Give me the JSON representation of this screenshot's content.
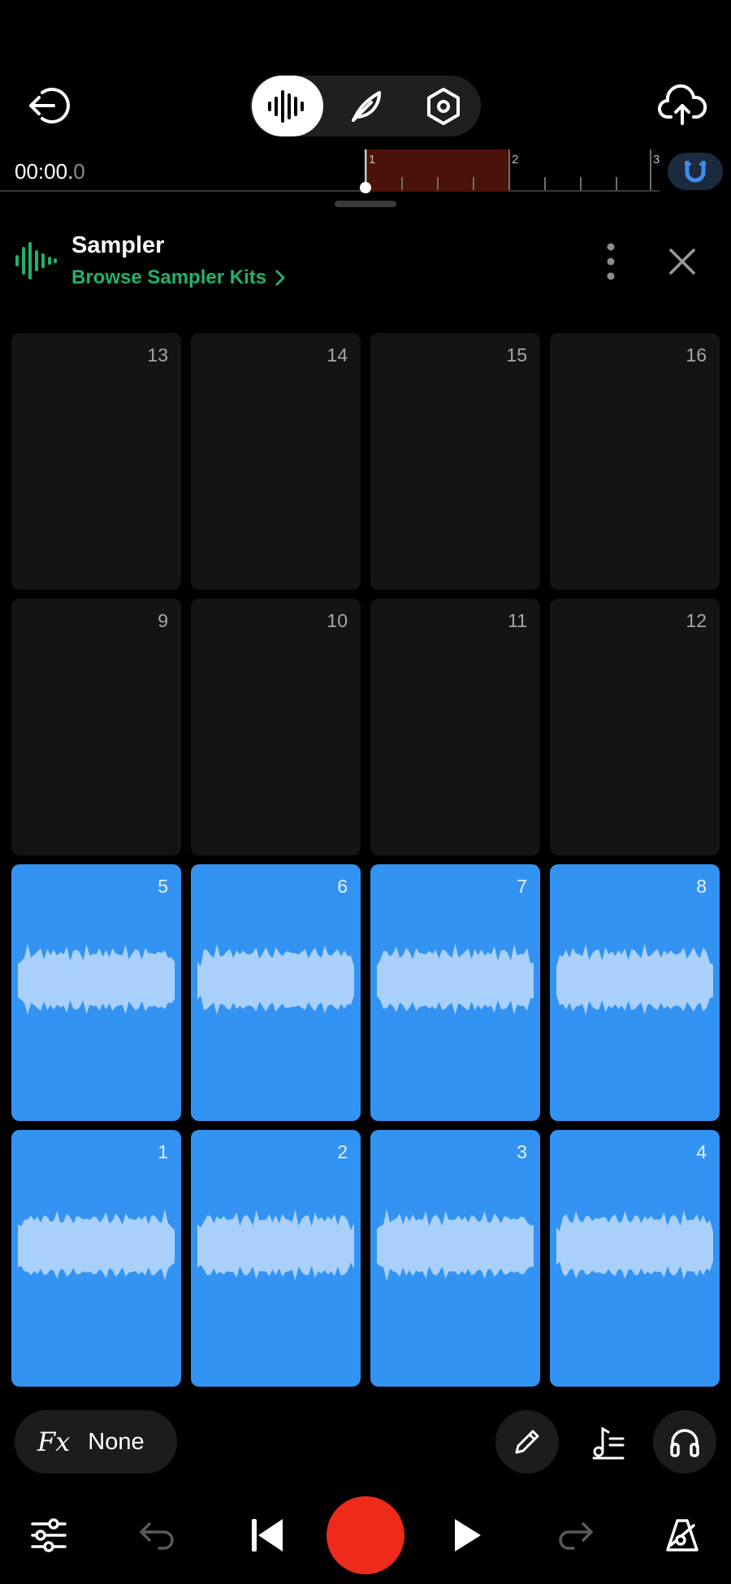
{
  "header": {
    "modes": [
      {
        "name": "instrument-mode",
        "active": true
      },
      {
        "name": "compose-mode",
        "active": false
      },
      {
        "name": "settings-mode",
        "active": false
      }
    ],
    "icons": {
      "exit": "exit-icon",
      "upload": "cloud-upload-icon",
      "waveform": "waveform-icon",
      "feather": "feather-icon",
      "hex-settings": "hex-settings-icon"
    }
  },
  "timeline": {
    "time_main": "00:00.",
    "time_ms": "0",
    "bar_numbers": [
      "1",
      "2",
      "3"
    ],
    "loop_region_color": "#4a1208",
    "snap_icon": "magnet-icon"
  },
  "instrument": {
    "name": "Sampler",
    "browse_label": "Browse Sampler Kits",
    "accent": "#20b36a"
  },
  "pads": {
    "rows": [
      [
        {
          "num": "13",
          "filled": false
        },
        {
          "num": "14",
          "filled": false
        },
        {
          "num": "15",
          "filled": false
        },
        {
          "num": "16",
          "filled": false
        }
      ],
      [
        {
          "num": "9",
          "filled": false
        },
        {
          "num": "10",
          "filled": false
        },
        {
          "num": "11",
          "filled": false
        },
        {
          "num": "12",
          "filled": false
        }
      ],
      [
        {
          "num": "5",
          "filled": true
        },
        {
          "num": "6",
          "filled": true
        },
        {
          "num": "7",
          "filled": true
        },
        {
          "num": "8",
          "filled": true
        }
      ],
      [
        {
          "num": "1",
          "filled": true
        },
        {
          "num": "2",
          "filled": true
        },
        {
          "num": "3",
          "filled": true
        },
        {
          "num": "4",
          "filled": true
        }
      ]
    ],
    "filled_color": "#3393f2",
    "empty_color": "#141416"
  },
  "toolbar": {
    "fx_label": "Fx",
    "fx_value": "None"
  },
  "transport": {
    "record_color": "#ee2a1a",
    "icons": [
      "mixer-icon",
      "undo-icon",
      "rewind-icon",
      "record-icon",
      "play-icon",
      "redo-icon",
      "metronome-icon"
    ]
  }
}
